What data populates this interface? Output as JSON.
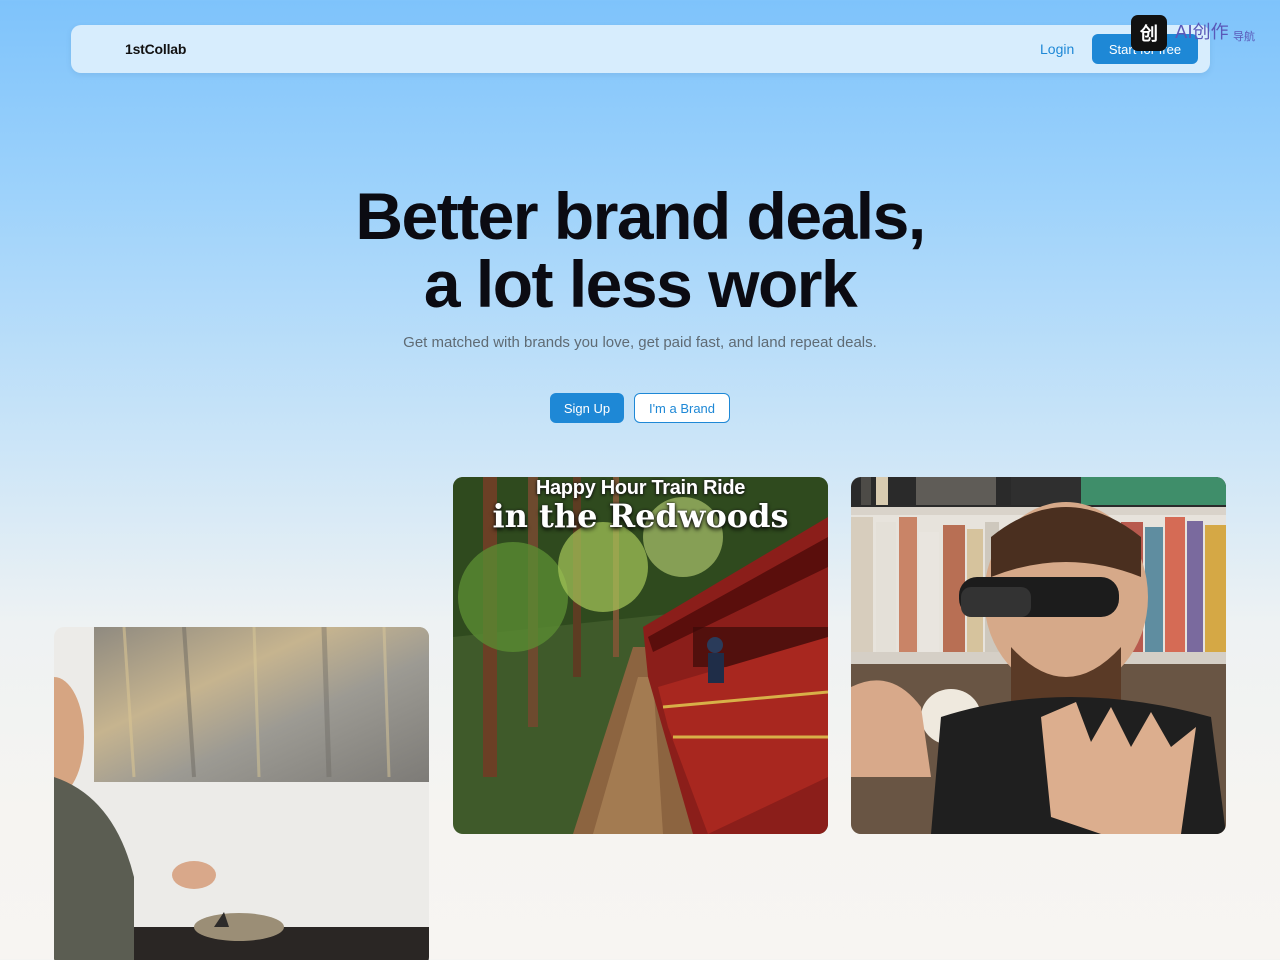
{
  "nav": {
    "logo": "1stCollab",
    "login": "Login",
    "start": "Start for free"
  },
  "watermark": {
    "icon_char": "创",
    "text": "AI创作",
    "sub": "导航"
  },
  "hero": {
    "title_line1": "Better brand deals,",
    "title_line2": "a lot less work",
    "subtitle": "Get matched with brands you love, get paid fast, and land repeat deals.",
    "signup": "Sign Up",
    "brand": "I'm a Brand"
  },
  "cards": [
    {
      "title": "",
      "caption": ""
    },
    {
      "title": "Happy Hour Train Ride",
      "caption": "in the Redwoods"
    },
    {
      "title": "",
      "caption": ""
    }
  ],
  "colors": {
    "accent": "#1e88d6",
    "nav_bg": "#d7edfd"
  }
}
